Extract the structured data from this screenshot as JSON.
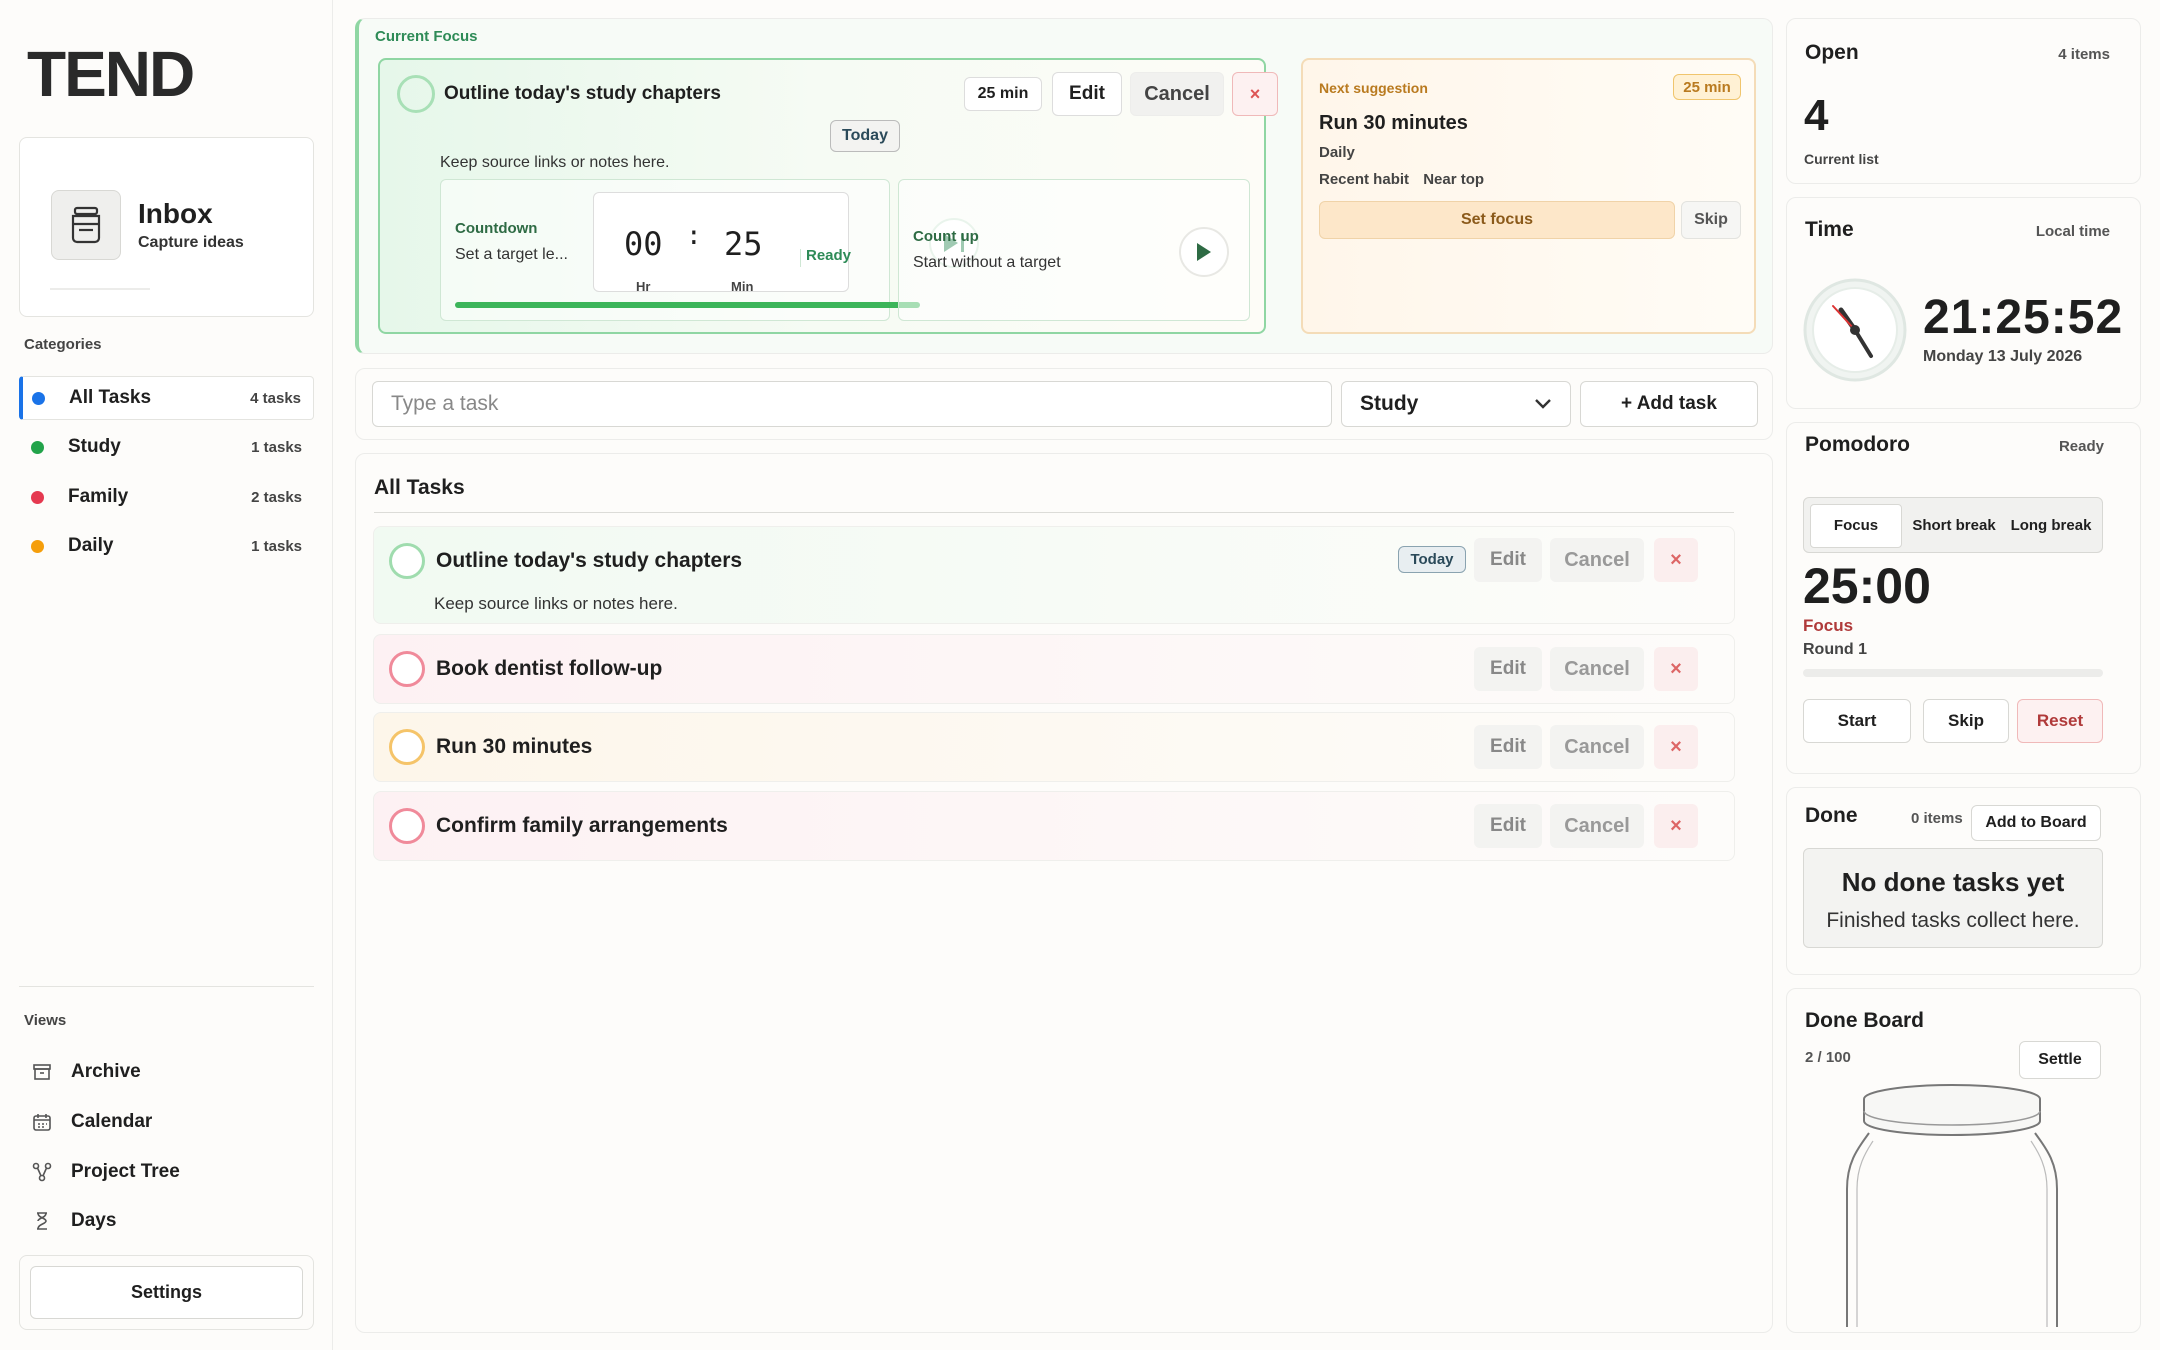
{
  "app": {
    "logo_text": "TEND"
  },
  "inbox": {
    "title": "Inbox",
    "subtitle": "Capture ideas"
  },
  "categories": {
    "heading": "Categories",
    "items": [
      {
        "label": "All Tasks",
        "count": "4 tasks",
        "color": "#1a73e8",
        "active": true
      },
      {
        "label": "Study",
        "count": "1 tasks",
        "color": "#22a34a"
      },
      {
        "label": "Family",
        "count": "2 tasks",
        "color": "#e53950"
      },
      {
        "label": "Daily",
        "count": "1 tasks",
        "color": "#f59e0b"
      }
    ]
  },
  "views": {
    "heading": "Views",
    "items": [
      {
        "label": "Archive",
        "icon": "archive-icon"
      },
      {
        "label": "Calendar",
        "icon": "calendar-icon"
      },
      {
        "label": "Project Tree",
        "icon": "tree-icon"
      },
      {
        "label": "Days",
        "icon": "hourglass-icon"
      }
    ]
  },
  "settings": {
    "label": "Settings"
  },
  "focus": {
    "heading": "Current Focus",
    "task_title": "Outline today's study chapters",
    "duration": "25 min",
    "edit_label": "Edit",
    "cancel_label": "Cancel",
    "close_label": "×",
    "tag": "Today",
    "notes": "Keep source links or notes here.",
    "countdown": {
      "label": "Countdown",
      "subtitle": "Set a target le...",
      "hours": "00",
      "colon": ":",
      "minutes": "25",
      "hours_label": "Hr",
      "minutes_label": "Min",
      "status": "Ready"
    },
    "countup": {
      "label": "Count up",
      "subtitle": "Start without a target"
    }
  },
  "suggestion": {
    "label": "Next suggestion",
    "duration": "25 min",
    "title": "Run 30 minutes",
    "category": "Daily",
    "tags": [
      "Recent habit",
      "Near top"
    ],
    "set_focus_label": "Set focus",
    "skip_label": "Skip"
  },
  "add_task": {
    "placeholder": "Type a task",
    "category": "Study",
    "button_label": "+ Add task"
  },
  "task_list": {
    "title": "All Tasks",
    "edit_label": "Edit",
    "cancel_label": "Cancel",
    "close_label": "×",
    "tasks": [
      {
        "title": "Outline today's study chapters",
        "tag": "Today",
        "notes": "Keep source links or notes here.",
        "color": "#22a34a"
      },
      {
        "title": "Book dentist follow-up",
        "color": "#e53950"
      },
      {
        "title": "Run 30 minutes",
        "color": "#f59e0b"
      },
      {
        "title": "Confirm family arrangements",
        "color": "#e53950"
      }
    ]
  },
  "open_panel": {
    "title": "Open",
    "meta": "4 items",
    "count": "4",
    "subtitle": "Current list"
  },
  "time_panel": {
    "title": "Time",
    "meta": "Local time",
    "time": "21:25:52",
    "date": "Monday 13 July 2026"
  },
  "pomodoro": {
    "title": "Pomodoro",
    "status": "Ready",
    "tabs": [
      "Focus",
      "Short break",
      "Long break"
    ],
    "time": "25:00",
    "mode": "Focus",
    "round": "Round 1",
    "progress": 0,
    "start_label": "Start",
    "skip_label": "Skip",
    "reset_label": "Reset"
  },
  "done_panel": {
    "title": "Done",
    "meta": "0 items",
    "add_label": "Add to Board",
    "empty_title": "No done tasks yet",
    "empty_sub": "Finished tasks collect here."
  },
  "done_board": {
    "title": "Done Board",
    "count": "2 / 100",
    "settle_label": "Settle"
  }
}
